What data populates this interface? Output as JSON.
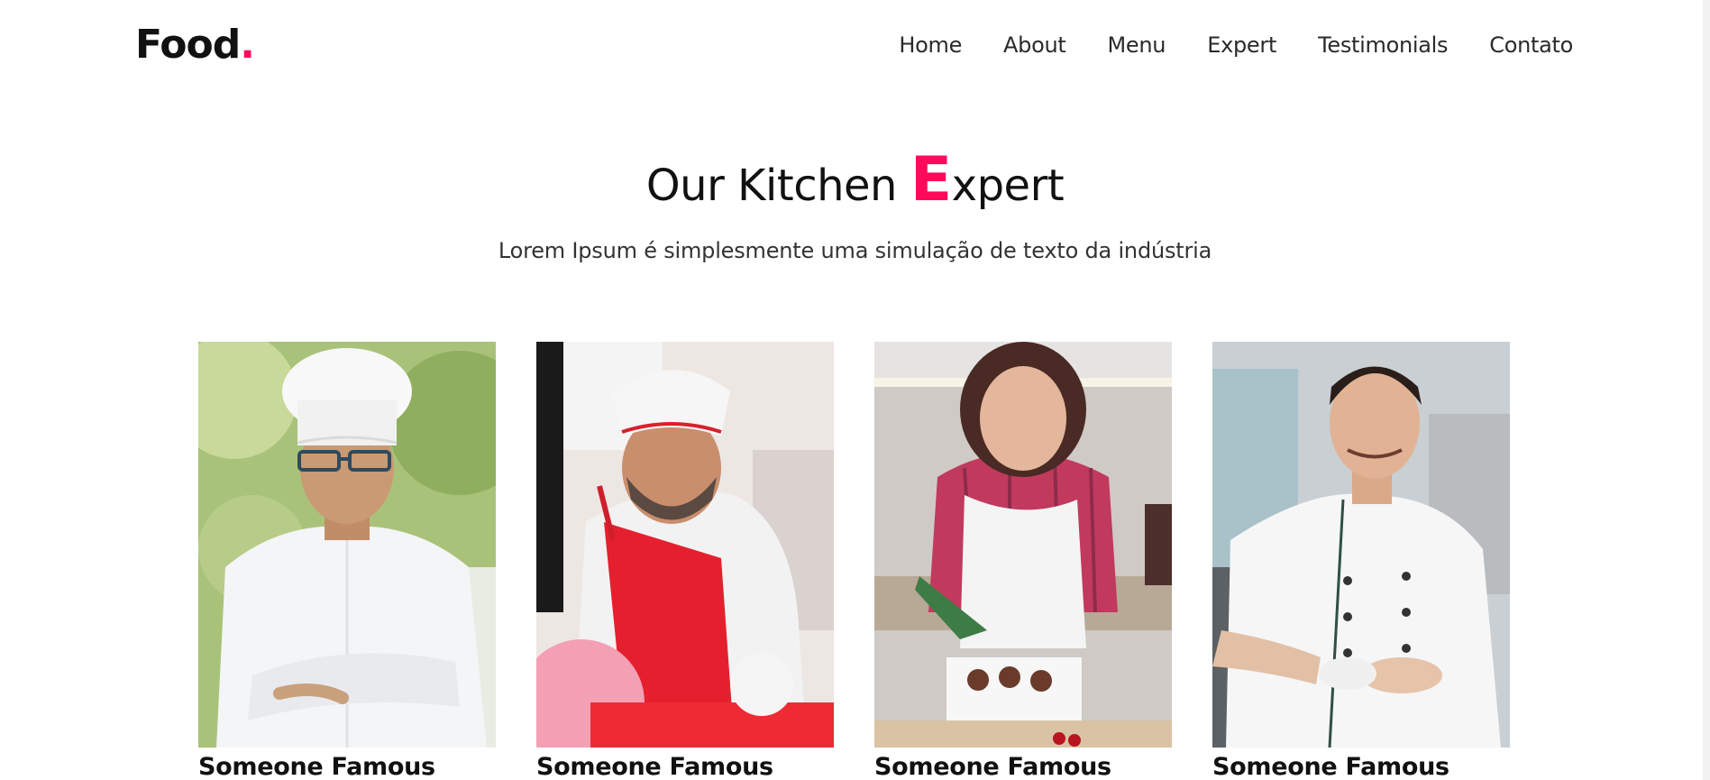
{
  "brand": {
    "name": "Food",
    "dot": ".",
    "accent_color": "#ff0a5a"
  },
  "nav": {
    "items": [
      {
        "label": "Home"
      },
      {
        "label": "About"
      },
      {
        "label": "Menu"
      },
      {
        "label": "Expert"
      },
      {
        "label": "Testimonials"
      },
      {
        "label": "Contato"
      }
    ]
  },
  "section": {
    "title_prefix": "Our Kitchen ",
    "title_highlight": "E",
    "title_suffix": "xpert",
    "subtitle": "Lorem Ipsum é simplesmente uma simulação de texto da indústria"
  },
  "experts": [
    {
      "name": "Someone Famous",
      "photo_icon": "chef-photo-white-hat-glasses"
    },
    {
      "name": "Someone Famous",
      "photo_icon": "chef-photo-red-apron"
    },
    {
      "name": "Someone Famous",
      "photo_icon": "baker-photo-woman-piping-bag"
    },
    {
      "name": "Someone Famous",
      "photo_icon": "chef-photo-coffee-cup"
    }
  ]
}
